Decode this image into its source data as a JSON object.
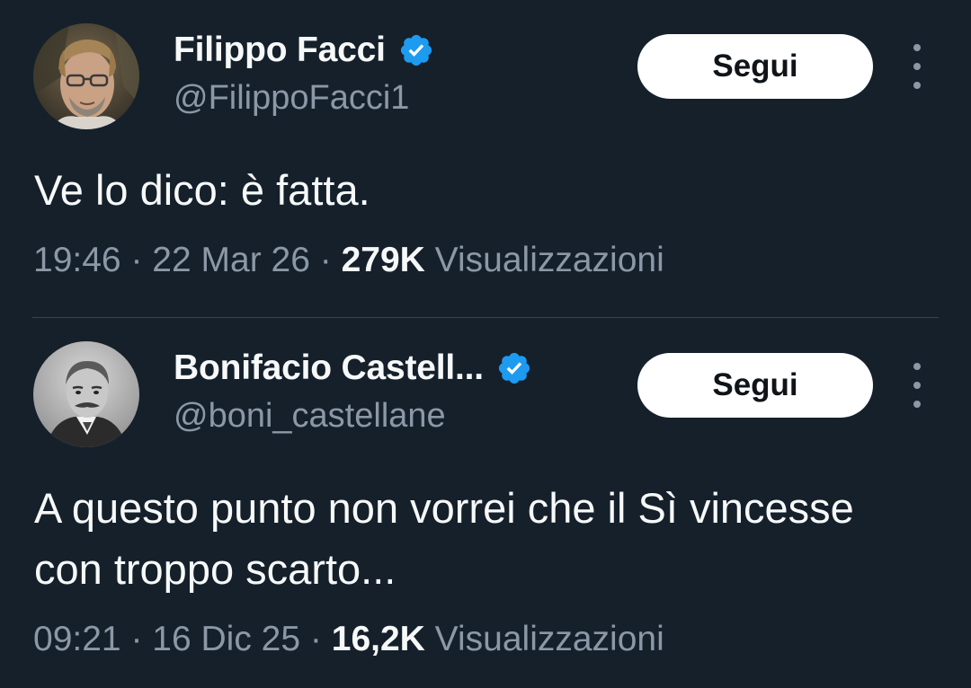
{
  "tweets": [
    {
      "author": {
        "name": "Filippo Facci",
        "handle": "@FilippoFacci1",
        "verified": true
      },
      "follow_label": "Segui",
      "text": "Ve lo dico: è fatta.",
      "time": "19:46",
      "separator": "·",
      "date": "22 Mar 26",
      "views_count": "279K",
      "views_label": "Visualizzazioni"
    },
    {
      "author": {
        "name": "Bonifacio Castell...",
        "handle": "@boni_castellane",
        "verified": true
      },
      "follow_label": "Segui",
      "text": "A questo punto non vorrei che il Sì vincesse con troppo scarto...",
      "time": "09:21",
      "separator": "·",
      "date": "16 Dic 25",
      "views_count": "16,2K",
      "views_label": "Visualizzazioni"
    }
  ],
  "icons": {
    "verified": "verified-badge-icon",
    "more": "more-vertical-icon"
  },
  "colors": {
    "background": "#15202b",
    "text_primary": "#f7f9f9",
    "text_secondary": "#8b98a5",
    "verified_blue": "#1d9bf0",
    "divider": "#38444d",
    "button_bg": "#ffffff",
    "button_text": "#0f1419"
  }
}
